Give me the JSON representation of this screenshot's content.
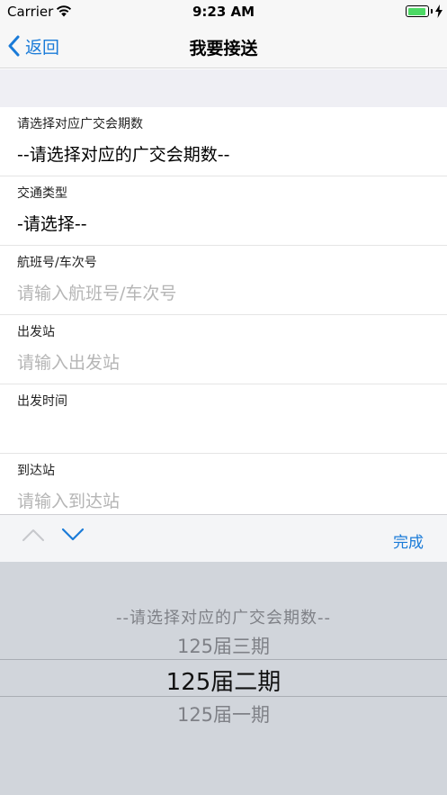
{
  "status_bar": {
    "carrier": "Carrier",
    "time": "9:23 AM"
  },
  "nav": {
    "back_label": "返回",
    "title": "我要接送"
  },
  "form": {
    "rows": [
      {
        "label": "请选择对应广交会期数",
        "value": "--请选择对应的广交会期数--",
        "placeholder": false
      },
      {
        "label": "交通类型",
        "value": "-请选择--",
        "placeholder": false
      },
      {
        "label": "航班号/车次号",
        "value": "请输入航班号/车次号",
        "placeholder": true
      },
      {
        "label": "出发站",
        "value": "请输入出发站",
        "placeholder": true
      },
      {
        "label": "出发时间",
        "value": "",
        "placeholder": false
      },
      {
        "label": "到达站",
        "value": "请输入到达站",
        "placeholder": true
      }
    ]
  },
  "toolbar": {
    "done_label": "完成"
  },
  "picker": {
    "options": [
      "--请选择对应的广交会期数--",
      "125届三期",
      "125届二期",
      "125届一期"
    ],
    "selected": "125届二期"
  },
  "colors": {
    "accent": "#1a7bd8",
    "battery": "#4cd964",
    "placeholder": "#b5b5b5",
    "picker_bg": "#d1d5db"
  }
}
